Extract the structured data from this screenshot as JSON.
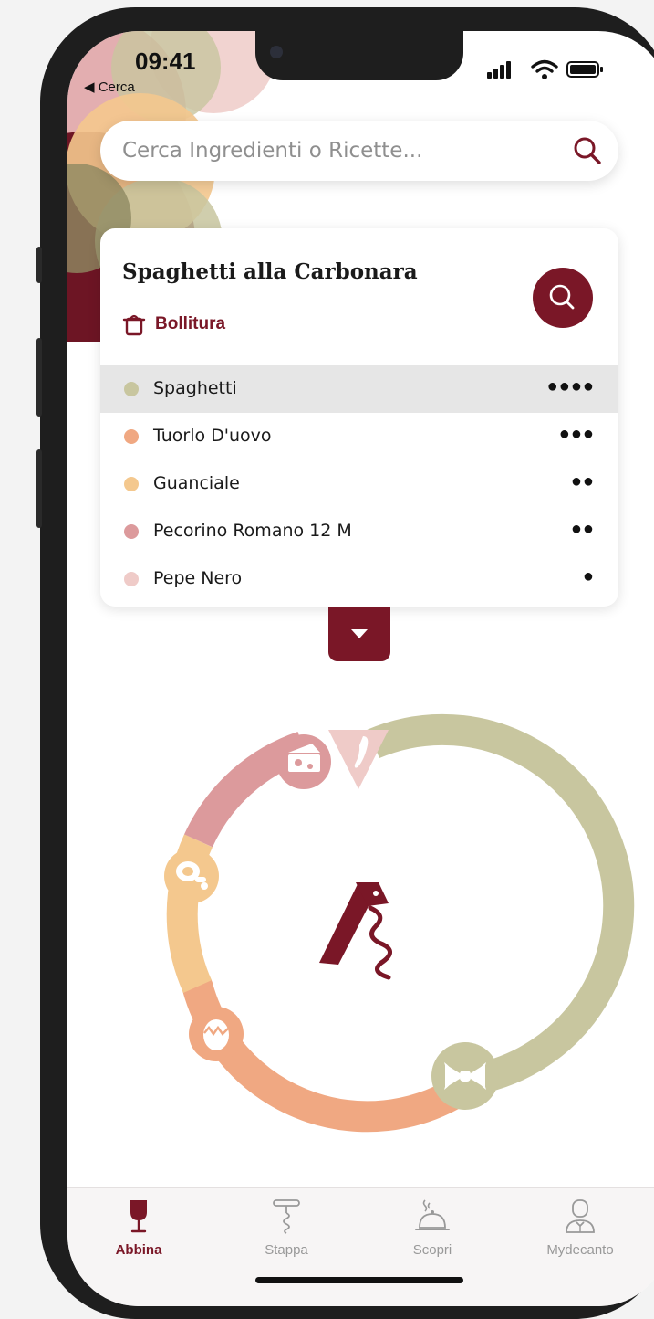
{
  "status_bar": {
    "time": "09:41",
    "back_label": "◀ Cerca"
  },
  "search": {
    "placeholder": "Cerca Ingredienti o Ricette..."
  },
  "recipe": {
    "title": "Spaghetti alla Carbonara",
    "cooking_method": "Bollitura",
    "ingredients": [
      {
        "name": "Spaghetti",
        "level": "●●●●",
        "color": "#c8c69f",
        "selected": true
      },
      {
        "name": "Tuorlo D'uovo",
        "level": "●●●",
        "color": "#f0a882"
      },
      {
        "name": "Guanciale",
        "level": "●●",
        "color": "#f4c88e"
      },
      {
        "name": "Pecorino Romano 12 M",
        "level": "●●",
        "color": "#dc9a9c"
      },
      {
        "name": "Pepe Nero",
        "level": "●",
        "color": "#efcbc8"
      }
    ]
  },
  "wheel": {
    "segments": [
      "Spaghetti",
      "Tuorlo D'uovo",
      "Guanciale",
      "Pecorino Romano 12 M",
      "Pepe Nero"
    ],
    "center_logo": "corkscrew-logo-icon"
  },
  "tabbar": {
    "tabs": [
      {
        "label": "Abbina",
        "icon": "wine-glass-icon",
        "active": true
      },
      {
        "label": "Stappa",
        "icon": "corkscrew-icon",
        "active": false
      },
      {
        "label": "Scopri",
        "icon": "cloche-icon",
        "active": false
      },
      {
        "label": "Mydecanto",
        "icon": "waiter-icon",
        "active": false
      }
    ]
  },
  "colors": {
    "accent": "#7a1727",
    "spaghetti": "#c8c69f",
    "egg": "#f0a882",
    "guanciale": "#f4c88e",
    "pecorino": "#dc9a9c",
    "pepper": "#efcbc8"
  }
}
